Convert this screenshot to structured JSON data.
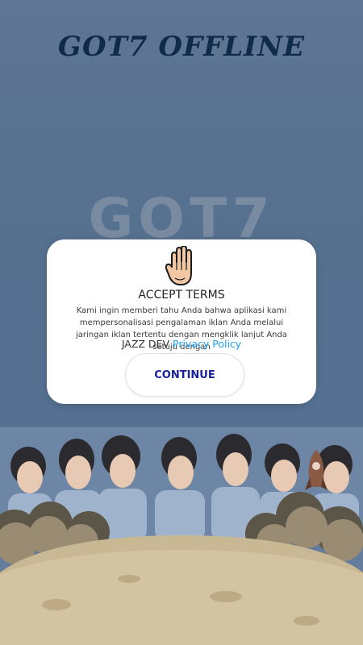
{
  "app": {
    "title": "GOT7 OFFLINE",
    "watermark": "GOT7"
  },
  "dialog": {
    "icon": "raised-hand-icon",
    "title": "ACCEPT TERMS",
    "body": "Kami ingin memberi tahu Anda bahwa aplikasi kami mempersonalisasi pengalaman iklan Anda melalui jaringan iklan tertentu dengan mengklik lanjut Anda setuju dengan",
    "developer": "JAZZ DEV",
    "privacy_link": "Privacy Policy",
    "continue_label": "CONTINUE"
  },
  "colors": {
    "background": "#55708f",
    "title": "#102a4a",
    "link": "#1da1f2",
    "button_text": "#16219a"
  }
}
